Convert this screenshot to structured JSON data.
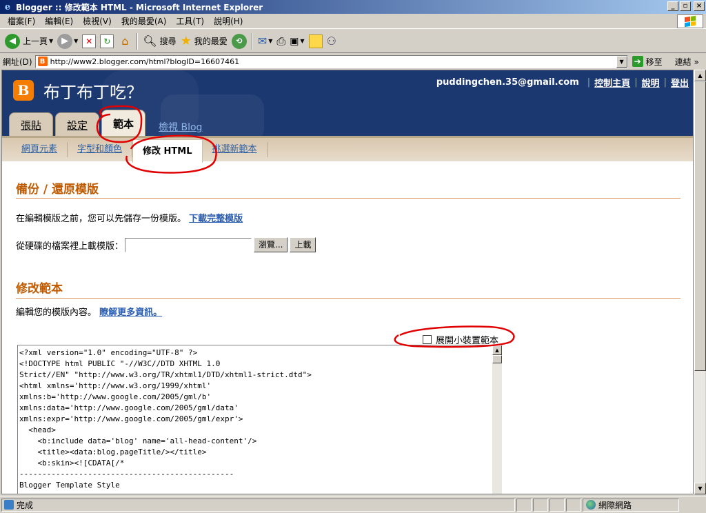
{
  "window": {
    "title": "Blogger :: 修改範本 HTML - Microsoft Internet Explorer",
    "app_icon": "ie-icon",
    "buttons": [
      "_",
      "▫",
      "×"
    ]
  },
  "menu": [
    "檔案(F)",
    "編輯(E)",
    "檢視(V)",
    "我的最愛(A)",
    "工具(T)",
    "說明(H)"
  ],
  "toolbar": {
    "back_label": "上一頁",
    "search_label": "搜尋",
    "favorites_label": "我的最愛"
  },
  "address": {
    "label": "網址(D)",
    "url": "http://www2.blogger.com/html?blogID=16607461",
    "go_label": "移至",
    "links_label": "連結 »"
  },
  "blog": {
    "title": "布丁布丁吃？",
    "user_email": "puddingchen.35@gmail.com",
    "header_links": [
      "控制主頁",
      "說明",
      "登出"
    ],
    "tabs": [
      {
        "label": "張貼",
        "active": false
      },
      {
        "label": "設定",
        "active": false
      },
      {
        "label": "範本",
        "active": true
      }
    ],
    "view_blog_label": "檢視 Blog",
    "subtabs": [
      {
        "label": "網頁元素",
        "active": false
      },
      {
        "label": "字型和顏色",
        "active": false
      },
      {
        "label": "修改 HTML",
        "active": true
      },
      {
        "label": "挑選新範本",
        "active": false
      }
    ]
  },
  "backup": {
    "title": "備份 / 還原模版",
    "desc": "在編輯模版之前，您可以先儲存一份模版。",
    "download_link": "下載完整模版",
    "upload_label": "從硬碟的檔案裡上載模版：",
    "upload_value": "",
    "browse_btn": "瀏覽...",
    "upload_btn": "上載"
  },
  "edit": {
    "title": "修改範本",
    "desc": "編輯您的模版內容。",
    "more_link": "瞭解更多資訊。",
    "expand_widgets_label": "展開小裝置範本",
    "expand_widgets_checked": false,
    "code": "<?xml version=\"1.0\" encoding=\"UTF-8\" ?>\n<!DOCTYPE html PUBLIC \"-//W3C//DTD XHTML 1.0\nStrict//EN\" \"http://www.w3.org/TR/xhtml1/DTD/xhtml1-strict.dtd\">\n<html xmlns='http://www.w3.org/1999/xhtml'\nxmlns:b='http://www.google.com/2005/gml/b'\nxmlns:data='http://www.google.com/2005/gml/data'\nxmlns:expr='http://www.google.com/2005/gml/expr'>\n  <head>\n    <b:include data='blog' name='all-head-content'/>\n    <title><data:blog.pageTitle/></title>\n    <b:skin><![CDATA[/*\n-----------------------------------------------\nBlogger Template Style"
  },
  "status": {
    "text": "完成",
    "zone": "網際網路"
  },
  "colors": {
    "header_bg": "#1c3870",
    "accent_orange": "#c05a00",
    "annotation_red": "#e00000"
  }
}
